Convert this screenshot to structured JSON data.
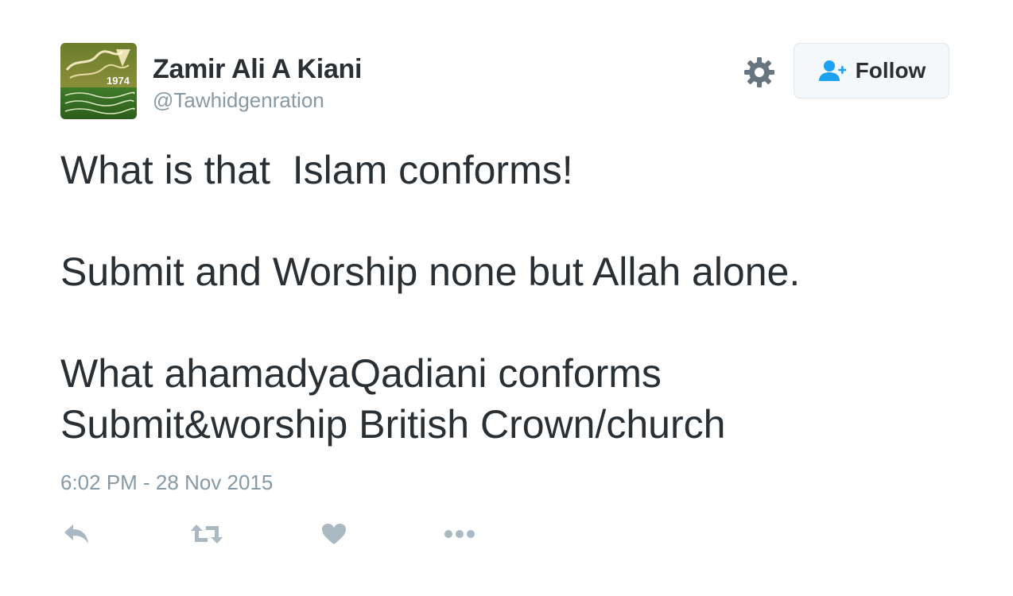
{
  "user": {
    "name": "Zamir Ali A Kiani",
    "handle": "@Tawhidgenration",
    "avatar_year": "1974"
  },
  "header": {
    "settings_icon": "gear-icon",
    "follow_label": "Follow",
    "follow_icon": "add-user-icon"
  },
  "tweet": {
    "lines": [
      "What is that  Islam conforms!",
      "",
      "Submit and Worship none but Allah alone.",
      "",
      "What ahamadyaQadiani conforms",
      "Submit&worship British Crown/church"
    ],
    "timestamp": "6:02 PM - 28 Nov 2015"
  },
  "actions": {
    "reply_icon": "reply-icon",
    "retweet_icon": "retweet-icon",
    "like_icon": "heart-icon",
    "more_icon": "more-dots-icon"
  },
  "colors": {
    "text": "#292f33",
    "muted": "#8899a6",
    "follow_blue": "#1da1f2",
    "icon_gray": "#aab8c2",
    "gear_gray": "#66757f",
    "button_border": "#e1e8ed",
    "button_bg": "#f5f8fa"
  }
}
